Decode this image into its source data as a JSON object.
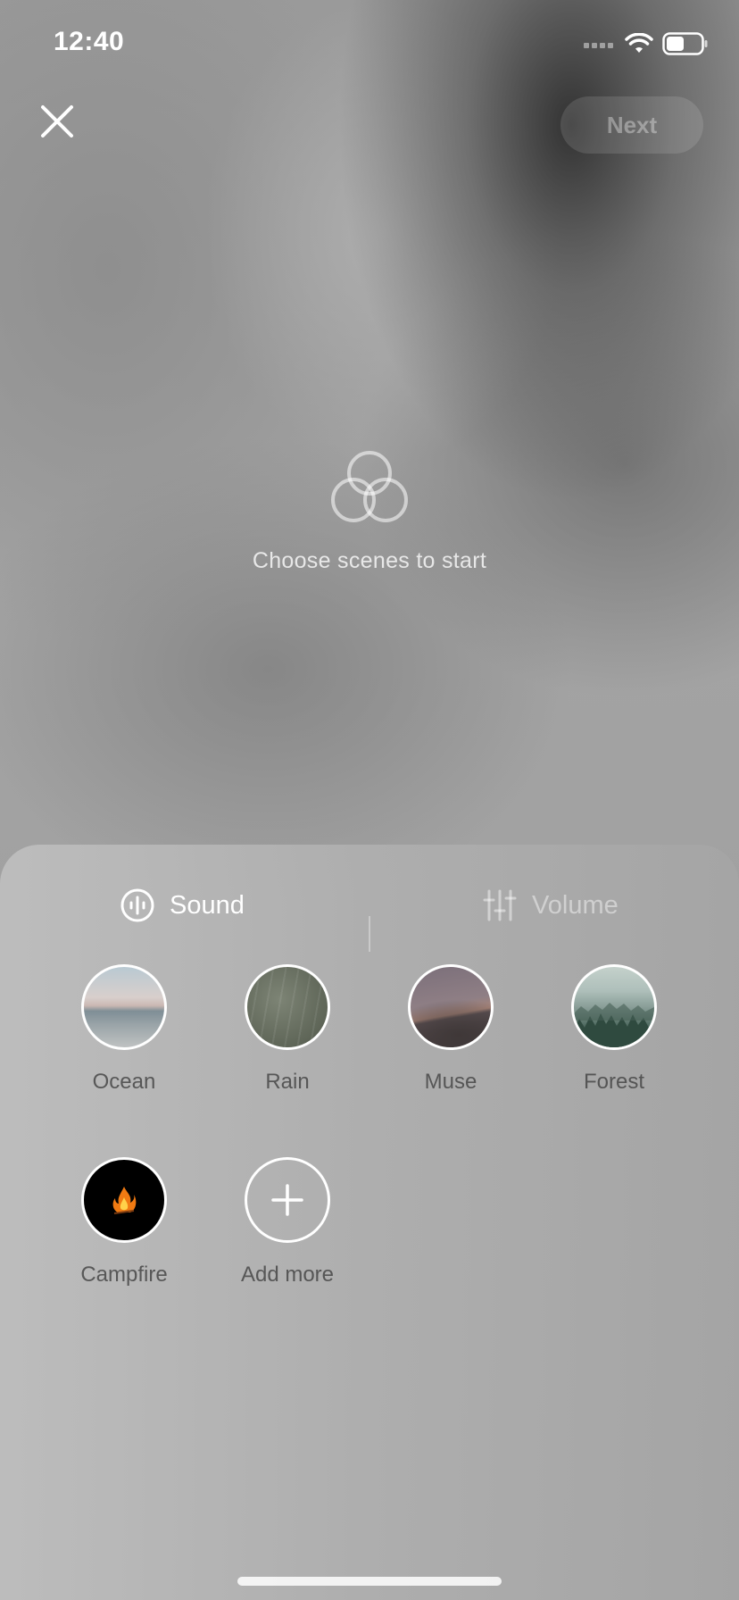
{
  "status_bar": {
    "time": "12:40",
    "icons": [
      "cellular-signal-icon",
      "wifi-icon",
      "battery-icon"
    ]
  },
  "header": {
    "close_icon": "close-icon",
    "next_label": "Next"
  },
  "empty_state": {
    "icon": "scenes-circles-icon",
    "message": "Choose scenes to start"
  },
  "sheet": {
    "tabs": [
      {
        "label": "Sound",
        "icon": "sound-wave-icon",
        "active": true
      },
      {
        "label": "Volume",
        "icon": "sliders-icon",
        "active": false
      }
    ],
    "scenes": [
      {
        "label": "Ocean"
      },
      {
        "label": "Rain"
      },
      {
        "label": "Muse"
      },
      {
        "label": "Forest"
      },
      {
        "label": "Campfire"
      },
      {
        "label": "Add more",
        "icon": "plus-icon"
      }
    ]
  },
  "colors": {
    "text_primary": "#ffffff",
    "text_label": "#4a4a4a",
    "next_button_text": "rgba(255,255,255,0.35)"
  }
}
